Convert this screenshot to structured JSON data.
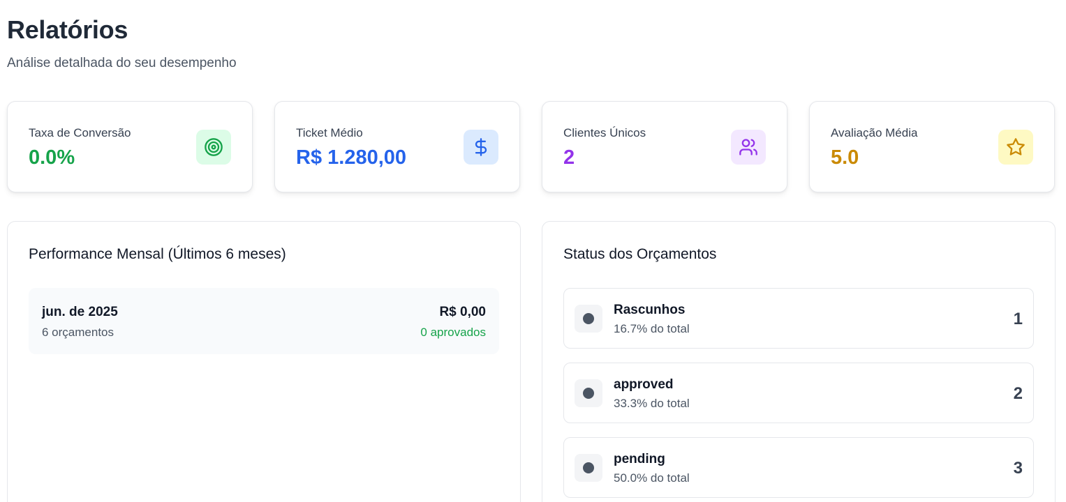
{
  "header": {
    "title": "Relatórios",
    "subtitle": "Análise detalhada do seu desempenho"
  },
  "kpis": [
    {
      "label": "Taxa de Conversão",
      "value": "0.0%",
      "icon": "target-icon",
      "color": "#16a34a",
      "icon_bg": "#dcfce7"
    },
    {
      "label": "Ticket Médio",
      "value": "R$ 1.280,00",
      "icon": "dollar-icon",
      "color": "#2563eb",
      "icon_bg": "#dbeafe"
    },
    {
      "label": "Clientes Únicos",
      "value": "2",
      "icon": "users-icon",
      "color": "#9333ea",
      "icon_bg": "#f3e8ff"
    },
    {
      "label": "Avaliação Média",
      "value": "5.0",
      "icon": "star-icon",
      "color": "#ca8a04",
      "icon_bg": "#fef9c3"
    }
  ],
  "monthly": {
    "title": "Performance Mensal (Últimos 6 meses)",
    "rows": [
      {
        "month": "jun. de 2025",
        "count": "6 orçamentos",
        "value": "R$ 0,00",
        "approved": "0 aprovados"
      }
    ]
  },
  "status": {
    "title": "Status dos Orçamentos",
    "items": [
      {
        "name": "Rascunhos",
        "pct": "16.7% do total",
        "count": "1"
      },
      {
        "name": "approved",
        "pct": "33.3% do total",
        "count": "2"
      },
      {
        "name": "pending",
        "pct": "50.0% do total",
        "count": "3"
      }
    ]
  }
}
